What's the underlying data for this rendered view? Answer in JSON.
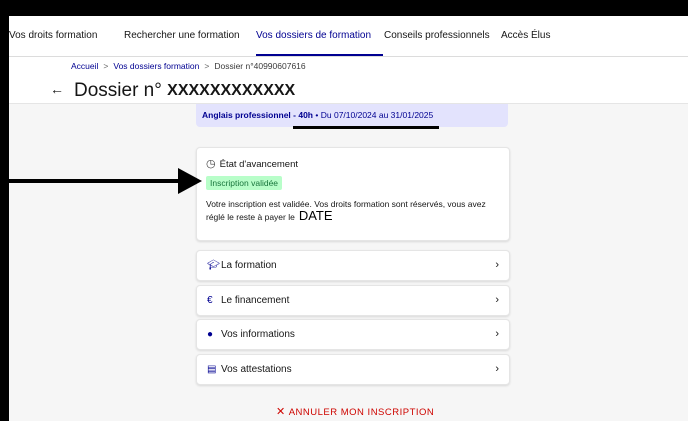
{
  "nav": {
    "items": [
      {
        "label": "Vos droits formation"
      },
      {
        "label": "Rechercher une formation"
      },
      {
        "label": "Vos dossiers de formation"
      },
      {
        "label": "Conseils professionnels"
      },
      {
        "label": "Accès Élus"
      }
    ],
    "active_index": 2
  },
  "breadcrumb": {
    "home": "Accueil",
    "separator": ">",
    "dossiers": "Vos dossiers formation",
    "current": "Dossier n°40990607616"
  },
  "page": {
    "back_icon": "arrow-left-icon",
    "title_prefix": "Dossier n°",
    "title_code": "XXXXXXXXXXXX"
  },
  "summary": {
    "course": "Anglais professionnel - 40h",
    "bullet": "•",
    "dates": "Du 07/10/2024 au 31/01/2025"
  },
  "status": {
    "icon": "clock-icon",
    "title": "État d'avancement",
    "badge": "Inscription validée",
    "message": "Votre inscription est validée. Vos droits formation sont réservés, vous avez réglé le reste à payer le",
    "date_placeholder": "DATE"
  },
  "accordion": [
    {
      "icon": "graduation-cap-icon",
      "label": "La formation"
    },
    {
      "icon": "euro-icon",
      "label": "Le financement"
    },
    {
      "icon": "user-icon",
      "label": "Vos informations"
    },
    {
      "icon": "document-icon",
      "label": "Vos attestations"
    }
  ],
  "cancel": {
    "icon": "close-icon",
    "label": "ANNULER MON INSCRIPTION"
  },
  "colors": {
    "accent": "#000091",
    "badge_bg": "#b8fec9",
    "badge_text": "#18753c",
    "danger": "#ce0500"
  }
}
